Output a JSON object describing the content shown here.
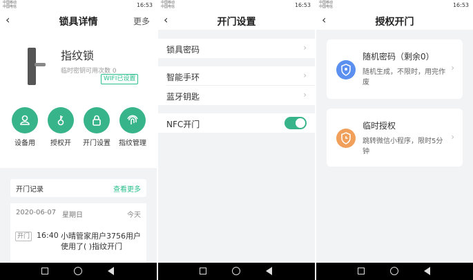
{
  "status": {
    "carrier_line1": "中国移动",
    "carrier_line2": "中国电信",
    "time": "16:53"
  },
  "panel1": {
    "title": "锁具详情",
    "more": "更多",
    "lock_name": "指纹锁",
    "temp_pwd_count": "临时密钥可用次数 0",
    "wifi_badge": "WIFI已设置",
    "functions": [
      {
        "label": "设备用",
        "icon": "user-lock-icon"
      },
      {
        "label": "授权开",
        "icon": "key-icon"
      },
      {
        "label": "开门设置",
        "icon": "lock-icon"
      },
      {
        "label": "指纹管理",
        "icon": "fingerprint-icon"
      }
    ],
    "record_title": "开门记录",
    "record_more": "查看更多",
    "entry": {
      "date": "2020-06-07",
      "weekday": "星期日",
      "today": "今天",
      "tag": "开门",
      "time": "16:40",
      "text": "小晴管家用户3756用户使用了(    )指纹开门"
    },
    "accent": "#38b48b"
  },
  "panel2": {
    "title": "开门设置",
    "rows": [
      {
        "label": "锁具密码"
      },
      {
        "label": "智能手环"
      },
      {
        "label": "蓝牙钥匙"
      },
      {
        "label": "NFC开门"
      }
    ],
    "nfc_enabled": true
  },
  "panel3": {
    "title": "授权开门",
    "cards": [
      {
        "title": "随机密码（剩余0）",
        "desc": "随机生成，不限时，用完作废",
        "icon": "shield-key-icon",
        "color": "#5b8ff0"
      },
      {
        "title": "临时授权",
        "desc": "跳转微信小程序，限时5分钟",
        "icon": "shield-clock-icon",
        "color": "#f0a05b"
      }
    ]
  }
}
